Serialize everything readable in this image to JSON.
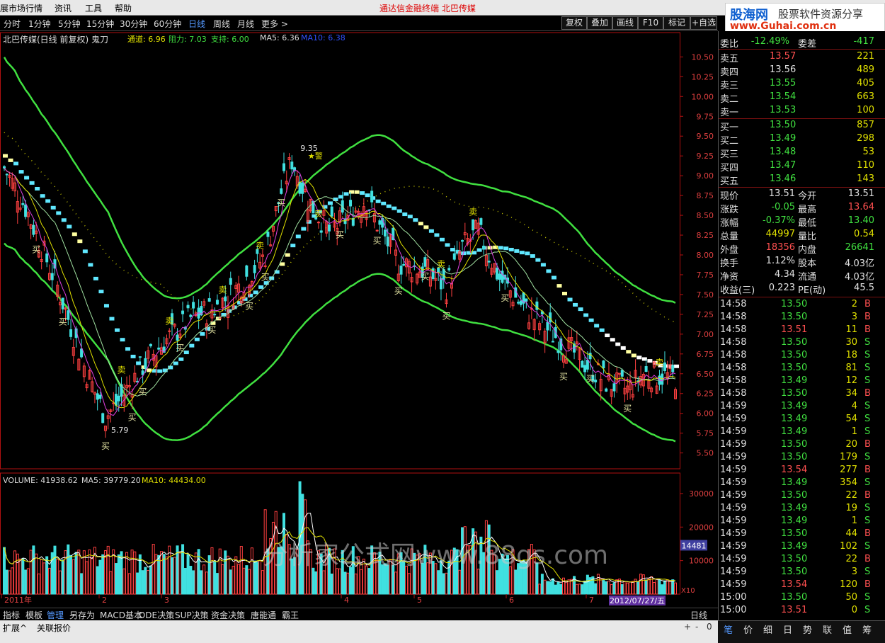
{
  "menu": {
    "items": [
      "展市场行情",
      "资讯",
      "工具",
      "帮助"
    ],
    "title": "通达信金融终端   北巴传媒"
  },
  "logo": {
    "brand": "股海网",
    "tagline": "股票软件资源分享",
    "url": "www.Guhai.com.cn"
  },
  "toolbar": {
    "periods": [
      "分时",
      "1分钟",
      "5分钟",
      "15分钟",
      "30分钟",
      "60分钟",
      "日线",
      "周线",
      "月线",
      "更多 >"
    ],
    "active": "日线",
    "buttons": [
      "复权",
      "叠加",
      "画线",
      "F10",
      "标记",
      "+自选"
    ]
  },
  "chart_header": {
    "name": "北巴传媒(日线 前复权) 鬼刀",
    "channel": "通道: 6.96",
    "resistance": "阻力: 7.03",
    "support": "支持: 6.00",
    "ma5": "MA5: 6.36",
    "ma10": "MA10: 6.38"
  },
  "volume_header": {
    "vol": "VOLUME: 41938.62",
    "ma5": "MA5: 39779.20",
    "ma10": "MA10: 44434.00"
  },
  "price_axis": [
    "10.50",
    "10.25",
    "10.00",
    "9.75",
    "9.50",
    "9.25",
    "9.00",
    "8.75",
    "8.50",
    "8.25",
    "8.00",
    "7.75",
    "7.50",
    "7.25",
    "7.00",
    "6.75",
    "6.50",
    "6.25",
    "6.00",
    "5.75",
    "5.50"
  ],
  "volume_axis": [
    "30000",
    "20000",
    "10000"
  ],
  "volume_marker": "14481",
  "x_labels": [
    "2011年",
    "2",
    "3",
    "4",
    "5",
    "6",
    "7"
  ],
  "x_cursor_date": "2012/07/27/五",
  "x_unit": "X10",
  "annotations": {
    "high": "9.35",
    "low": "5.79",
    "buy": "买",
    "sell": "卖",
    "alert": "警"
  },
  "watermark": "分析家公式网www.88gs.com",
  "colors": {
    "up": "#ff4040",
    "down": "#40e0e0",
    "band": "#40e040",
    "ma5": "#ffffff",
    "ma10": "#e0e000",
    "ma_purple": "#e040e0",
    "step": "#60e8ff",
    "axis": "#b01010"
  },
  "bottom_tabs": [
    "指标",
    "模板",
    "管理",
    "另存为",
    "MACD基本",
    "DDE决策",
    "SUP决策",
    "资金决策",
    "唐能通",
    "霸王"
  ],
  "bottom_active": "管理",
  "bottom_right": "日线",
  "status": [
    "扩展^",
    "关联报价"
  ],
  "quote": {
    "ratio": {
      "label": "委比",
      "value": "-12.49%",
      "label2": "委差",
      "value2": "-417"
    },
    "sell": [
      {
        "label": "卖五",
        "price": "13.57",
        "vol": "221"
      },
      {
        "label": "卖四",
        "price": "13.56",
        "vol": "489"
      },
      {
        "label": "卖三",
        "price": "13.55",
        "vol": "405"
      },
      {
        "label": "卖二",
        "price": "13.54",
        "vol": "663"
      },
      {
        "label": "卖一",
        "price": "13.53",
        "vol": "100"
      }
    ],
    "buy": [
      {
        "label": "买一",
        "price": "13.50",
        "vol": "857"
      },
      {
        "label": "买二",
        "price": "13.49",
        "vol": "298"
      },
      {
        "label": "买三",
        "price": "13.48",
        "vol": "53"
      },
      {
        "label": "买四",
        "price": "13.47",
        "vol": "110"
      },
      {
        "label": "买五",
        "price": "13.46",
        "vol": "143"
      }
    ],
    "stats": [
      {
        "l1": "现价",
        "v1": "13.51",
        "l2": "今开",
        "v2": "13.51"
      },
      {
        "l1": "涨跌",
        "v1": "-0.05",
        "l2": "最高",
        "v2": "13.64"
      },
      {
        "l1": "涨幅",
        "v1": "-0.37%",
        "l2": "最低",
        "v2": "13.40"
      },
      {
        "l1": "总量",
        "v1": "44997",
        "l2": "量比",
        "v2": "0.54"
      },
      {
        "l1": "外盘",
        "v1": "18356",
        "l2": "内盘",
        "v2": "26641"
      },
      {
        "l1": "换手",
        "v1": "1.12%",
        "l2": "股本",
        "v2": "4.03亿"
      },
      {
        "l1": "净资",
        "v1": "4.34",
        "l2": "流通",
        "v2": "4.03亿"
      },
      {
        "l1": "收益(三)",
        "v1": "0.223",
        "l2": "PE(动)",
        "v2": "45.5"
      }
    ],
    "ticks": [
      {
        "t": "14:58",
        "p": "13.50",
        "v": "2",
        "s": "B"
      },
      {
        "t": "14:58",
        "p": "13.50",
        "v": "3",
        "s": "B"
      },
      {
        "t": "14:58",
        "p": "13.51",
        "v": "11",
        "s": "B"
      },
      {
        "t": "14:58",
        "p": "13.50",
        "v": "30",
        "s": "S"
      },
      {
        "t": "14:58",
        "p": "13.50",
        "v": "18",
        "s": "S"
      },
      {
        "t": "14:58",
        "p": "13.50",
        "v": "81",
        "s": "S"
      },
      {
        "t": "14:58",
        "p": "13.49",
        "v": "12",
        "s": "S"
      },
      {
        "t": "14:58",
        "p": "13.50",
        "v": "34",
        "s": "B"
      },
      {
        "t": "14:59",
        "p": "13.49",
        "v": "4",
        "s": "S"
      },
      {
        "t": "14:59",
        "p": "13.49",
        "v": "54",
        "s": "S"
      },
      {
        "t": "14:59",
        "p": "13.49",
        "v": "1",
        "s": "S"
      },
      {
        "t": "14:59",
        "p": "13.50",
        "v": "20",
        "s": "B"
      },
      {
        "t": "14:59",
        "p": "13.50",
        "v": "179",
        "s": "S"
      },
      {
        "t": "14:59",
        "p": "13.54",
        "v": "277",
        "s": "B"
      },
      {
        "t": "14:59",
        "p": "13.49",
        "v": "354",
        "s": "S"
      },
      {
        "t": "14:59",
        "p": "13.50",
        "v": "22",
        "s": "B"
      },
      {
        "t": "14:59",
        "p": "13.49",
        "v": "19",
        "s": "S"
      },
      {
        "t": "14:59",
        "p": "13.49",
        "v": "1",
        "s": "S"
      },
      {
        "t": "14:59",
        "p": "13.50",
        "v": "44",
        "s": "B"
      },
      {
        "t": "14:59",
        "p": "13.49",
        "v": "102",
        "s": "S"
      },
      {
        "t": "14:59",
        "p": "13.50",
        "v": "22",
        "s": "B"
      },
      {
        "t": "14:59",
        "p": "13.50",
        "v": "3",
        "s": "S"
      },
      {
        "t": "14:59",
        "p": "13.54",
        "v": "120",
        "s": "B"
      },
      {
        "t": "15:00",
        "p": "13.50",
        "v": "50",
        "s": "S"
      },
      {
        "t": "15:00",
        "p": "13.51",
        "v": "0",
        "s": "S"
      }
    ]
  },
  "rp_tabs": [
    "笔",
    "价",
    "细",
    "日",
    "势",
    "联",
    "值",
    "筹"
  ],
  "rp_active": "笔"
}
